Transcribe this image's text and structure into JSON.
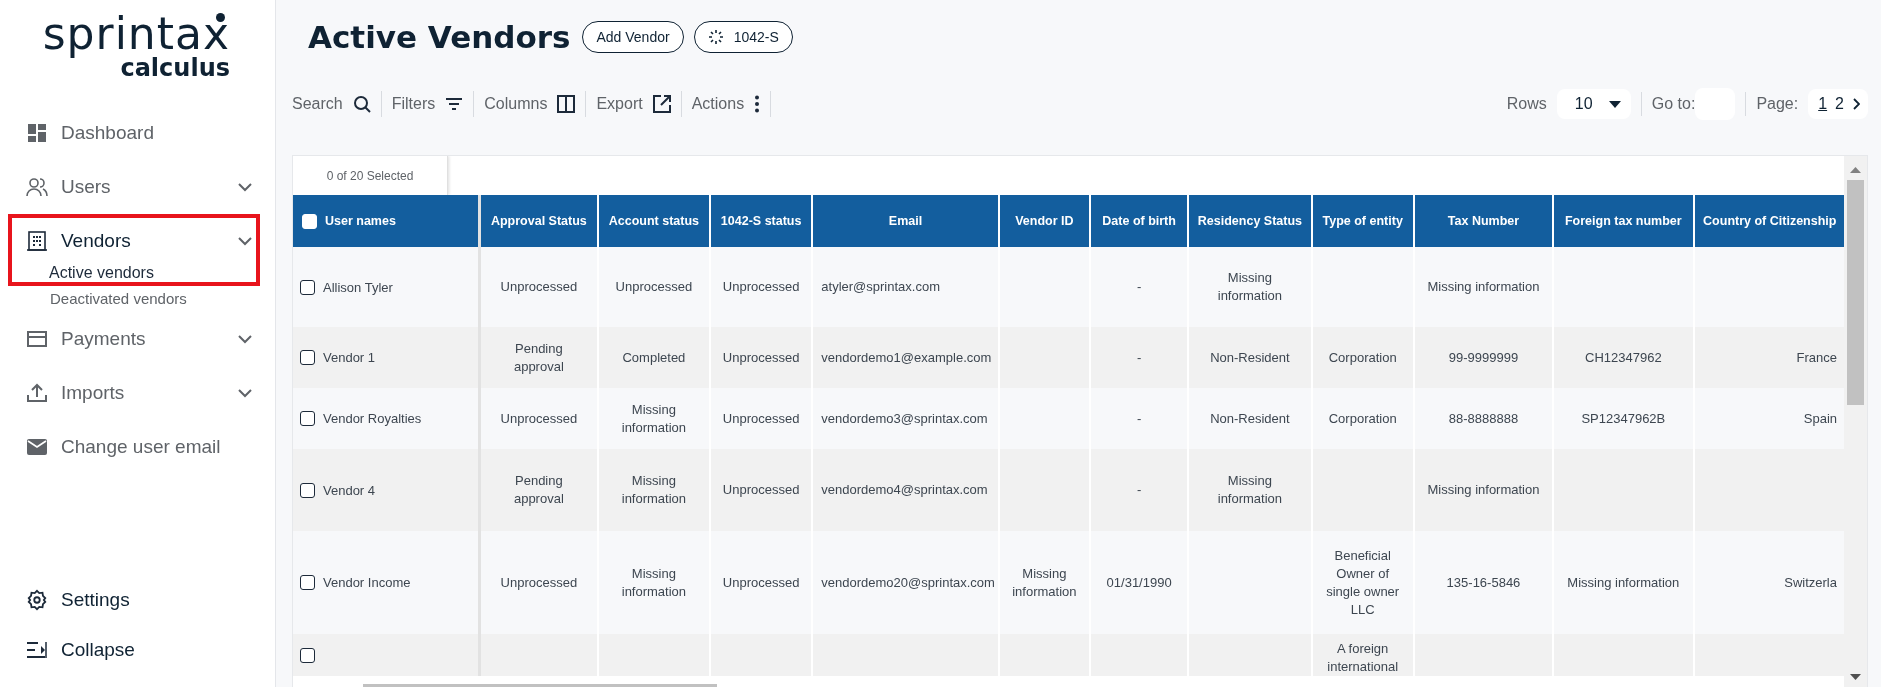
{
  "logo": {
    "name": "sprintax",
    "sub": "calculus"
  },
  "sidebar": {
    "items": [
      {
        "label": "Dashboard",
        "expandable": false,
        "expanded": false,
        "highlighted": false
      },
      {
        "label": "Users",
        "expandable": true,
        "expanded": false,
        "highlighted": false
      },
      {
        "label": "Vendors",
        "expandable": true,
        "expanded": true,
        "highlighted": true,
        "children": [
          {
            "label": "Active vendors",
            "selected": true
          },
          {
            "label": "Deactivated vendors",
            "selected": false
          }
        ]
      },
      {
        "label": "Payments",
        "expandable": true,
        "expanded": false,
        "highlighted": false
      },
      {
        "label": "Imports",
        "expandable": true,
        "expanded": false,
        "highlighted": false
      },
      {
        "label": "Change user email",
        "expandable": false,
        "expanded": false,
        "highlighted": false
      }
    ],
    "footer_items": [
      {
        "label": "Settings"
      },
      {
        "label": "Collapse"
      }
    ]
  },
  "header": {
    "title": "Active Vendors",
    "buttons": [
      {
        "label": "Add Vendor",
        "kind": "plain"
      },
      {
        "label": "1042-S",
        "kind": "loading"
      }
    ]
  },
  "toolbar": {
    "tools": [
      {
        "label": "Search"
      },
      {
        "label": "Filters"
      },
      {
        "label": "Columns"
      },
      {
        "label": "Export"
      },
      {
        "label": "Actions"
      }
    ],
    "rows": {
      "label": "Rows",
      "value": "10"
    },
    "goto": {
      "label": "Go to:"
    },
    "pagination": {
      "label": "Page:",
      "pages": [
        {
          "label": "1",
          "selected": true
        },
        {
          "label": "2",
          "selected": false
        }
      ]
    }
  },
  "table": {
    "selection_count": "0 of 20 Selected",
    "select_all_checked": false,
    "columns": [
      "User names",
      "Approval Status",
      "Account status",
      "1042-S status",
      "Email",
      "Vendor ID",
      "Date of birth",
      "Residency Status",
      "Type of entity",
      "Tax Number",
      "Foreign tax number",
      "Country of Citizenship"
    ],
    "rows": [
      {
        "checked": false,
        "cells": [
          "Allison Tyler",
          "Unprocessed",
          "Unprocessed",
          "Unprocessed",
          "atyler@sprintax.com",
          null,
          "-",
          "Missing information",
          null,
          "Missing information",
          null,
          null
        ]
      },
      {
        "checked": false,
        "cells": [
          "Vendor 1",
          "Pending approval",
          "Completed",
          "Unprocessed",
          "vendordemo1@example.com",
          null,
          "-",
          "Non-Resident",
          "Corporation",
          "99-9999999",
          "CH12347962",
          "France"
        ]
      },
      {
        "checked": false,
        "cells": [
          "Vendor Royalties",
          "Unprocessed",
          "Missing information",
          "Unprocessed",
          "vendordemo3@sprintax.com",
          null,
          "-",
          "Non-Resident",
          "Corporation",
          "88-8888888",
          "SP12347962B",
          "Spain"
        ]
      },
      {
        "checked": false,
        "cells": [
          "Vendor 4",
          "Pending approval",
          "Missing information",
          "Unprocessed",
          "vendordemo4@sprintax.com",
          null,
          "-",
          "Missing information",
          null,
          "Missing information",
          null,
          null
        ]
      },
      {
        "checked": false,
        "cells": [
          "Vendor Income",
          "Unprocessed",
          "Missing information",
          "Unprocessed",
          "vendordemo20@sprintax.com",
          "Missing information",
          "01/31/1990",
          null,
          "Beneficial Owner of single owner LLC",
          "135-16-5846",
          "Missing information",
          "Switzerla"
        ]
      },
      {
        "checked": false,
        "cells": [
          null,
          null,
          null,
          null,
          null,
          null,
          null,
          null,
          "A foreign international",
          null,
          null,
          null
        ]
      }
    ]
  }
}
